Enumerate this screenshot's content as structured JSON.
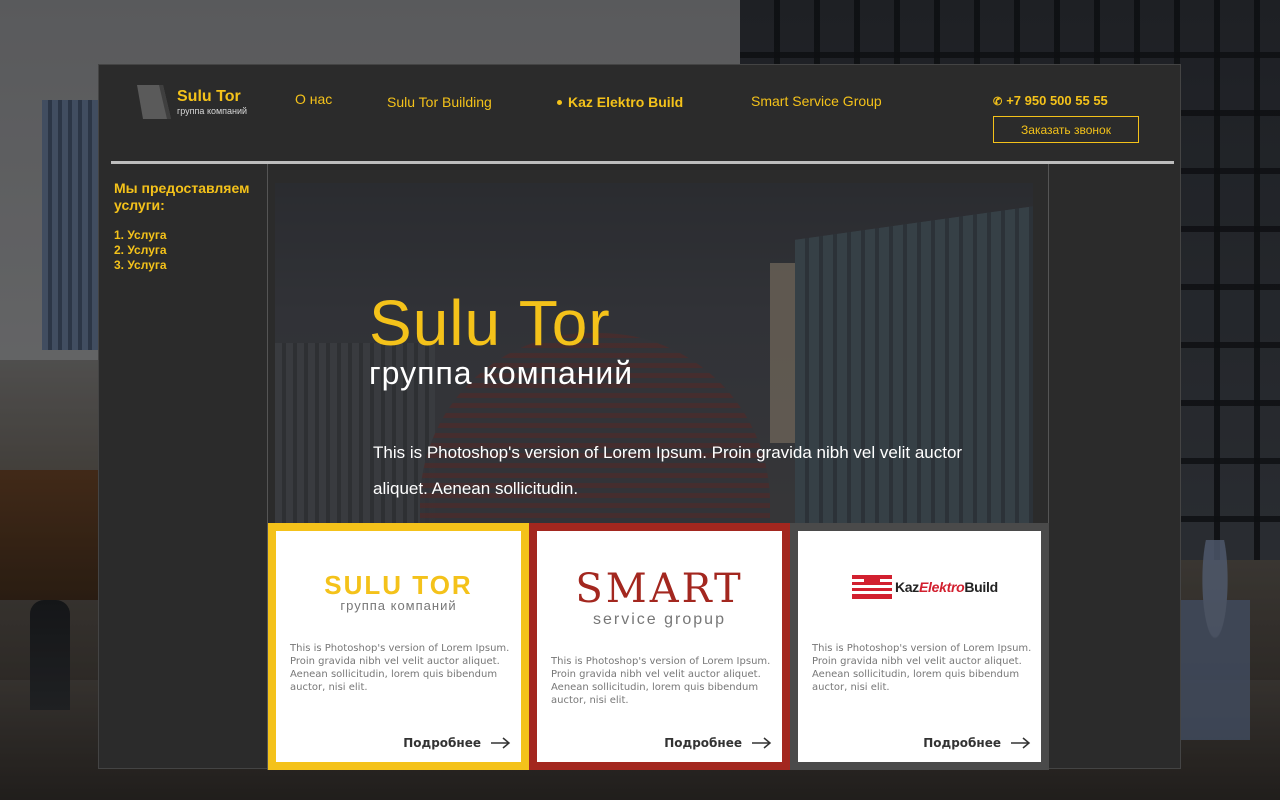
{
  "header": {
    "logo_title": "Sulu Tor",
    "logo_subtitle": "группа компаний",
    "nav": [
      {
        "label": "О нас",
        "active": false
      },
      {
        "label": "Sulu Tor Building",
        "active": false
      },
      {
        "label": "Kaz Elektro Build",
        "active": true
      },
      {
        "label": "Smart Service Group",
        "active": false
      }
    ],
    "phone": "+7 950 500 55 55",
    "callback_label": "Заказать звонок"
  },
  "sidebar": {
    "title": "Мы предоставляем услуги:",
    "items": [
      "1. Услуга",
      "2. Услуга",
      "3. Услуга"
    ]
  },
  "hero": {
    "title": "Sulu Tor",
    "subtitle": "группа компаний",
    "text": "This is Photoshop's version  of Lorem Ipsum. Proin gravida nibh vel velit auctor aliquet.  Aenean sollicitudin."
  },
  "cards": [
    {
      "brand_title": "SULU TOR",
      "brand_subtitle": "группа компаний",
      "description": "This is Photoshop's version  of Lorem Ipsum. Proin gravida nibh vel velit auctor aliquet. Aenean sollicitudin, lorem quis bibendum auctor, nisi elit.",
      "more_label": "Подробнее",
      "border_color": "#f4c21a"
    },
    {
      "brand_title": "SMART",
      "brand_subtitle": "service gropup",
      "description": "This is Photoshop's version  of Lorem Ipsum. Proin gravida nibh vel velit auctor aliquet. Aenean sollicitudin, lorem quis bibendum auctor, nisi elit.",
      "more_label": "Подробнее",
      "border_color": "#a3271f"
    },
    {
      "brand_title_part1": "Kaz",
      "brand_title_part2": "Elektro",
      "brand_title_part3": "Build",
      "description": "This is Photoshop's version  of Lorem Ipsum. Proin gravida nibh vel velit auctor aliquet. Aenean sollicitudin, lorem quis bibendum auctor, nisi elit.",
      "more_label": "Подробнее",
      "border_color": "#4a4a4a"
    }
  ],
  "colors": {
    "accent": "#f4c21a",
    "panel": "#2b2b2b",
    "smart_red": "#a3271f",
    "kaz_red": "#d2202f"
  },
  "icons": [
    "logo-mark-icon",
    "phone-icon",
    "arrow-right-icon",
    "kaz-logo-icon"
  ]
}
